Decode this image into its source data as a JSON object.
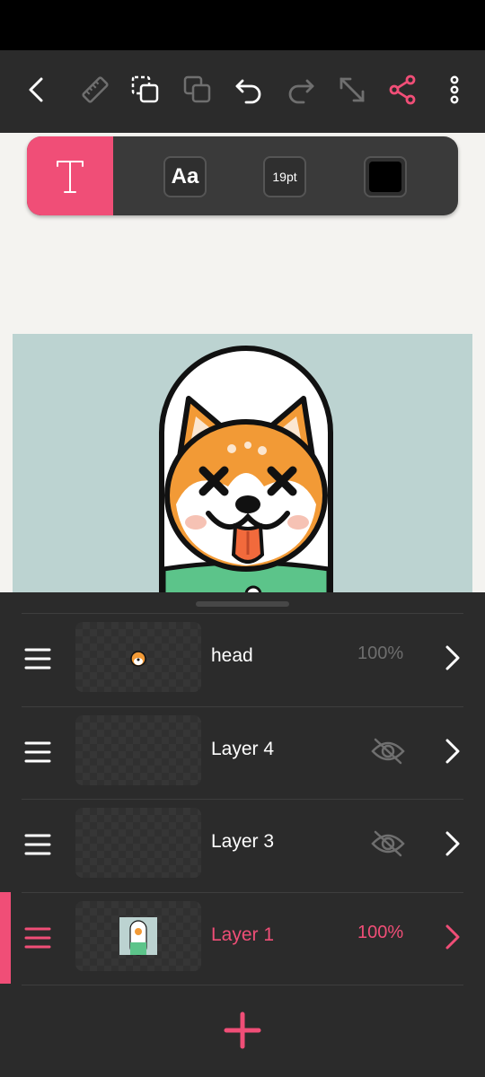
{
  "colors": {
    "accent": "#f04e77",
    "toolbar_bg": "#2b2b2b",
    "panel_bg": "#2b2b2b",
    "canvas_bg": "#f4f3f0",
    "artboard_bg": "#bcd3d1",
    "current_text_color": "#000000"
  },
  "toolbar": {
    "icons": [
      "back-icon",
      "ruler-icon",
      "select-icon",
      "duplicate-icon",
      "undo-icon",
      "redo-icon",
      "resize-icon",
      "share-icon",
      "more-icon"
    ]
  },
  "text_tools": {
    "font_label": "Aa",
    "size_label": "19pt",
    "color": "#000000"
  },
  "layers": [
    {
      "name": "head",
      "opacity": "100%",
      "visible": true,
      "selected": false
    },
    {
      "name": "Layer 4",
      "opacity": "",
      "visible": false,
      "selected": false
    },
    {
      "name": "Layer 3",
      "opacity": "",
      "visible": false,
      "selected": false
    },
    {
      "name": "Layer 1",
      "opacity": "100%",
      "visible": true,
      "selected": true
    }
  ]
}
